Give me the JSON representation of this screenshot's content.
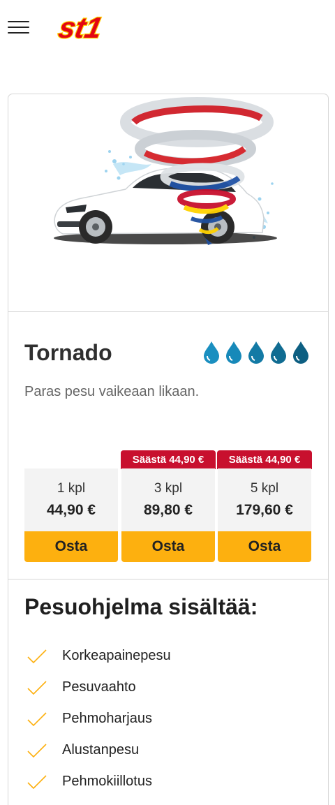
{
  "brand": {
    "logo_text": "st1"
  },
  "product": {
    "name": "Tornado",
    "description": "Paras pesu vaikeaan likaan.",
    "drop_count": 5
  },
  "options": [
    {
      "quantity": "1 kpl",
      "price": "44,90 €",
      "buy_label": "Osta",
      "savings": ""
    },
    {
      "quantity": "3 kpl",
      "price": "89,80 €",
      "buy_label": "Osta",
      "savings": "Säästä 44,90 €"
    },
    {
      "quantity": "5 kpl",
      "price": "179,60 €",
      "buy_label": "Osta",
      "savings": "Säästä 44,90 €"
    }
  ],
  "includes": {
    "title": "Pesuohjelma sisältää:",
    "items": [
      "Korkeapainepesu",
      "Pesuvaahto",
      "Pehmoharjaus",
      "Alustanpesu",
      "Pehmokiillotus"
    ]
  },
  "colors": {
    "accent": "#fdb00f",
    "brand_red": "#c8102e",
    "drop": "#1a8fc0"
  }
}
